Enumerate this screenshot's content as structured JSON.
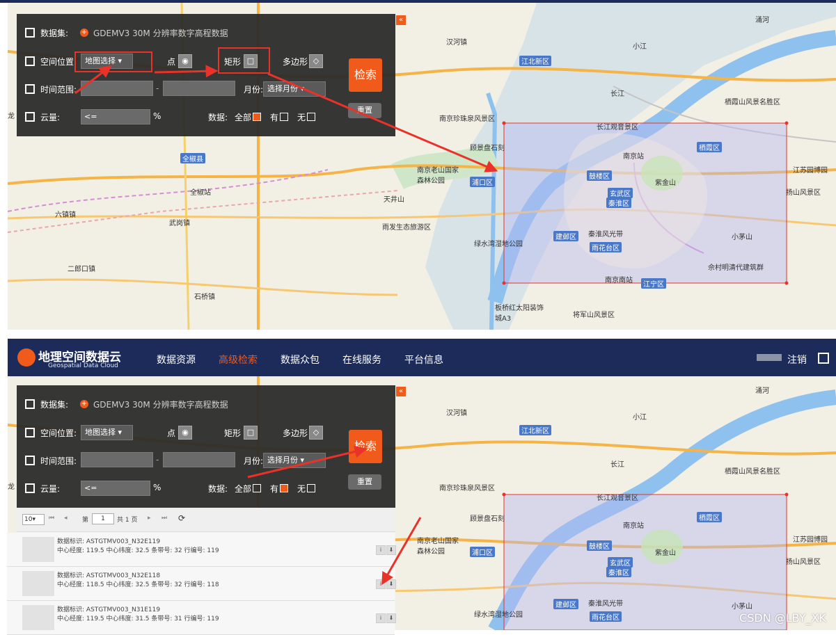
{
  "top": {
    "dataset_label": "数据集:",
    "dataset_value": "GDEMV3 30M 分辨率数字高程数据",
    "location_label": "空间位置:",
    "location_select": "地图选择",
    "point_label": "点",
    "rect_label": "矩形",
    "polygon_label": "多边形",
    "search_button": "检索",
    "reset_button": "重置",
    "time_label": "时间范围:",
    "time_dash": "-",
    "month_label": "月份:",
    "month_select": "选择月份",
    "cloud_label": "云量:",
    "cloud_op": "<=",
    "percent": "%",
    "data_label": "数据:",
    "data_all": "全部",
    "data_yes": "有",
    "data_no": "无",
    "collapse": "«",
    "data_all_checked": true,
    "data_yes_checked": false
  },
  "bottom": {
    "dataset_label": "数据集:",
    "dataset_value": "GDEMV3 30M 分辨率数字高程数据",
    "location_label": "空间位置:",
    "location_select": "地图选择",
    "point_label": "点",
    "rect_label": "矩形",
    "polygon_label": "多边形",
    "search_button": "检索",
    "reset_button": "重置",
    "time_label": "时间范围:",
    "time_dash": "-",
    "month_label": "月份:",
    "month_select": "选择月份",
    "cloud_label": "云量:",
    "cloud_op": "<=",
    "percent": "%",
    "data_label": "数据:",
    "data_all": "全部",
    "data_yes": "有",
    "data_no": "无",
    "collapse": "«",
    "data_all_checked": false,
    "data_yes_checked": true
  },
  "header": {
    "logo_cn": "地理空间数据云",
    "logo_en": "Geospatial Data Cloud",
    "nav": [
      "数据资源",
      "高级检索",
      "数据众包",
      "在线服务",
      "平台信息"
    ],
    "active_nav": "高级检索",
    "logout": "注销"
  },
  "pager": {
    "page_size": "10",
    "page_prefix": "第",
    "page_num": "1",
    "page_total": "共 1 页"
  },
  "results": [
    {
      "id_label": "数据标识:",
      "id": "ASTGTMV003_N32E119",
      "info": "中心经度:  119.5 中心纬度:  32.5 条带号: 32 行编号: 119"
    },
    {
      "id_label": "数据标识:",
      "id": "ASTGTMV003_N32E118",
      "info": "中心经度:  118.5 中心纬度:  32.5 条带号: 32 行编号: 118"
    },
    {
      "id_label": "数据标识:",
      "id": "ASTGTMV003_N31E119",
      "info": "中心经度:  119.5 中心纬度:  31.5 条带号: 31 行编号: 119"
    }
  ],
  "map_labels": {
    "nanjing_station": "南京站",
    "nanjing_south": "南京南站",
    "zijinshan": "紫金山",
    "xuanwu": "玄武区",
    "qinhuai": "秦淮区",
    "gulou": "鼓楼区",
    "jianye": "建邺区",
    "yuhuatai": "雨花台区",
    "qixia": "栖霞区",
    "jiangning": "江宁区",
    "pukou": "浦口区",
    "jiangbei": "江北新区",
    "quanjiao": "全椒县",
    "quanjiao_station": "全椒站",
    "laoshan": "南京老山国家森林公园",
    "tianjing": "天井山",
    "zhujiang": "南京珍珠泉风景区",
    "xiaomaoshan": "小茅山",
    "qixiashan": "栖霞山风景名胜区",
    "changjiang": "长江",
    "changjiang_scenic": "长江观音景区",
    "banqiao": "板桥红太阳装饰城A3",
    "jiangjunshan": "将军山风景区",
    "lvshui": "绿水湾湿地公园",
    "qinhuaifeng": "秦淮风光带",
    "yangshanguan": "扬山风景区",
    "jiangsu_park": "江苏园博园",
    "hanheshi": "汉河镇",
    "wu": "武岗镇",
    "shiqiao": "石桥镇",
    "erlang": "二郎口镇",
    "liuying": "六镇镇",
    "yinghe": "涌河",
    "yuhua_park": "雨发生态旅游区",
    "shicun": "佘村明清代建筑群",
    "dinggou": "顾景盘石刻",
    "xiaojiang": "小江",
    "long": "龙"
  },
  "watermark": "CSDN @LBY_XK",
  "colors": {
    "accent": "#f05a1a",
    "annotation": "#e8322a",
    "navbar": "#1c2b5a",
    "selection": "#b8b8f0"
  }
}
